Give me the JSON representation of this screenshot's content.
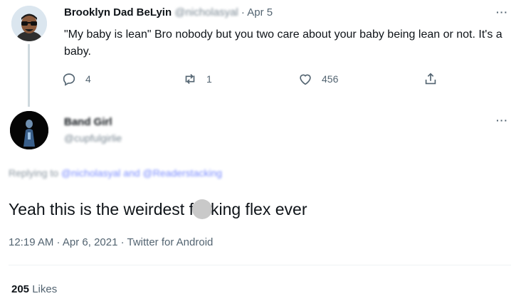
{
  "parent_tweet": {
    "author_name": "Brooklyn Dad BeLyin",
    "author_handle": "@nicholasyal",
    "separator": "·",
    "date": "Apr 5",
    "more_icon": "···",
    "text": "\"My baby is lean\" Bro nobody but you two care about your baby being lean or not. It's a baby.",
    "actions": {
      "reply_count": "4",
      "retweet_count": "1",
      "like_count": "456"
    }
  },
  "reply_tweet": {
    "author_name": "Band Girl",
    "author_handle": "@cupfulgirlie",
    "more_icon": "···",
    "replying_prefix": "Replying to",
    "replying_to": "@nicholasyal and @Readerstacking",
    "text_before": "Yeah this is the weirdest f",
    "text_after": "king flex ever",
    "timestamp": "12:19 AM · Apr 6, 2021 · Twitter for Android",
    "likes_count": "205",
    "likes_label": "Likes"
  },
  "colors": {
    "text": "#0f1419",
    "muted": "#536471",
    "link": "#7a8cff",
    "thread_line": "#cfd9de"
  }
}
